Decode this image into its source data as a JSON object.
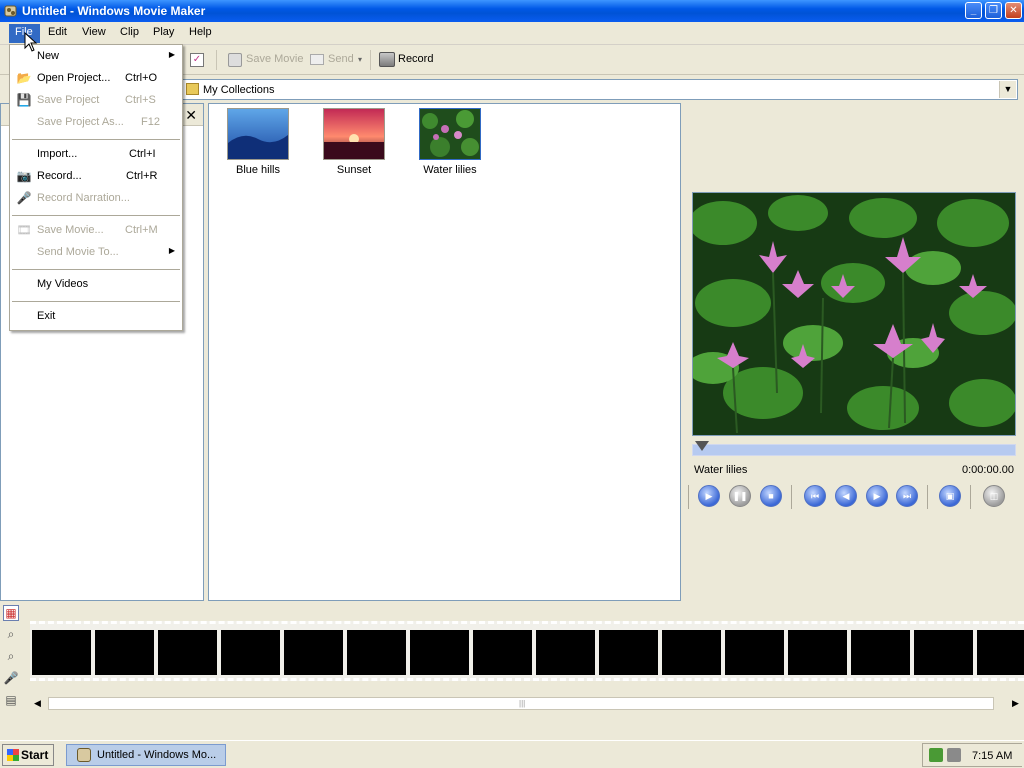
{
  "window": {
    "title": "Untitled - Windows Movie Maker",
    "min_label": "_",
    "max_label": "❐",
    "close_label": "✕"
  },
  "menubar": {
    "file": "File",
    "edit": "Edit",
    "view": "View",
    "clip": "Clip",
    "play": "Play",
    "help": "Help"
  },
  "toolbar": {
    "save_movie": "Save Movie",
    "send": "Send",
    "record": "Record"
  },
  "collections": {
    "current": "My Collections"
  },
  "file_menu": {
    "items": [
      {
        "label": "New",
        "shortcut": "",
        "enabled": true,
        "submenu": true,
        "icon": "new"
      },
      {
        "label": "Open Project...",
        "shortcut": "Ctrl+O",
        "enabled": true,
        "submenu": false,
        "icon": "folder-open-icon"
      },
      {
        "label": "Save Project",
        "shortcut": "Ctrl+S",
        "enabled": false,
        "submenu": false,
        "icon": "floppy-icon"
      },
      {
        "label": "Save Project As...",
        "shortcut": "F12",
        "enabled": false,
        "submenu": false,
        "icon": ""
      },
      {
        "label": "Import...",
        "shortcut": "Ctrl+I",
        "enabled": true,
        "submenu": false,
        "icon": ""
      },
      {
        "label": "Record...",
        "shortcut": "Ctrl+R",
        "enabled": true,
        "submenu": false,
        "icon": "camera-icon"
      },
      {
        "label": "Record Narration...",
        "shortcut": "",
        "enabled": false,
        "submenu": false,
        "icon": "microphone-icon"
      },
      {
        "label": "Save Movie...",
        "shortcut": "Ctrl+M",
        "enabled": false,
        "submenu": false,
        "icon": "save-movie-icon"
      },
      {
        "label": "Send Movie To...",
        "shortcut": "",
        "enabled": false,
        "submenu": true,
        "icon": ""
      },
      {
        "label": "My Videos",
        "shortcut": "",
        "enabled": true,
        "submenu": false,
        "icon": ""
      },
      {
        "label": "Exit",
        "shortcut": "",
        "enabled": true,
        "submenu": false,
        "icon": ""
      }
    ]
  },
  "tasks_pane": {
    "close_label": "✕"
  },
  "contents": {
    "clips": [
      {
        "name": "Blue hills",
        "colors": [
          "#1d4aa3",
          "#5fa6e8"
        ]
      },
      {
        "name": "Sunset",
        "colors": [
          "#c22a55",
          "#ff8a6e"
        ]
      },
      {
        "name": "Water lilies",
        "colors": [
          "#1f4d1c",
          "#c56fb6"
        ]
      }
    ]
  },
  "preview": {
    "clip_name": "Water lilies",
    "time": "0:00:00.00",
    "position": 0
  },
  "taskbar": {
    "start": "Start",
    "task": "Untitled - Windows Mo...",
    "clock": "7:15 AM"
  }
}
